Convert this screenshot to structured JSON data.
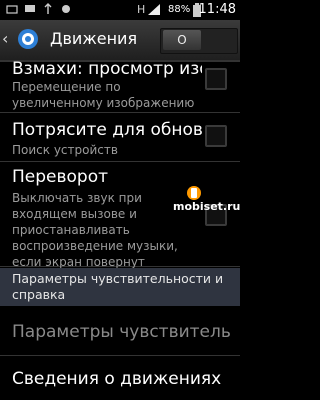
{
  "status_bar": {
    "network": "H",
    "battery": "88%",
    "time": "11:48"
  },
  "action_bar": {
    "title": "Движения",
    "toggle_label": "O"
  },
  "items": [
    {
      "title": "Взмахи: просмотр изо...",
      "subtitle": "Перемещение по увеличенному изображению"
    },
    {
      "title": "Потрясите для обновл...",
      "subtitle": "Поиск устройств"
    },
    {
      "title": "Переворот",
      "subtitle": "Выключать звук при входящем вызове и приостанавливать воспроизведение музыки, если экран повернут"
    }
  ],
  "section": {
    "label": "Параметры чувствительности и справка"
  },
  "sensitivity": {
    "title": "Параметры чувствительн..."
  },
  "about": {
    "title": "Сведения о движениях"
  },
  "watermark": {
    "text": "mobiset.ru"
  }
}
